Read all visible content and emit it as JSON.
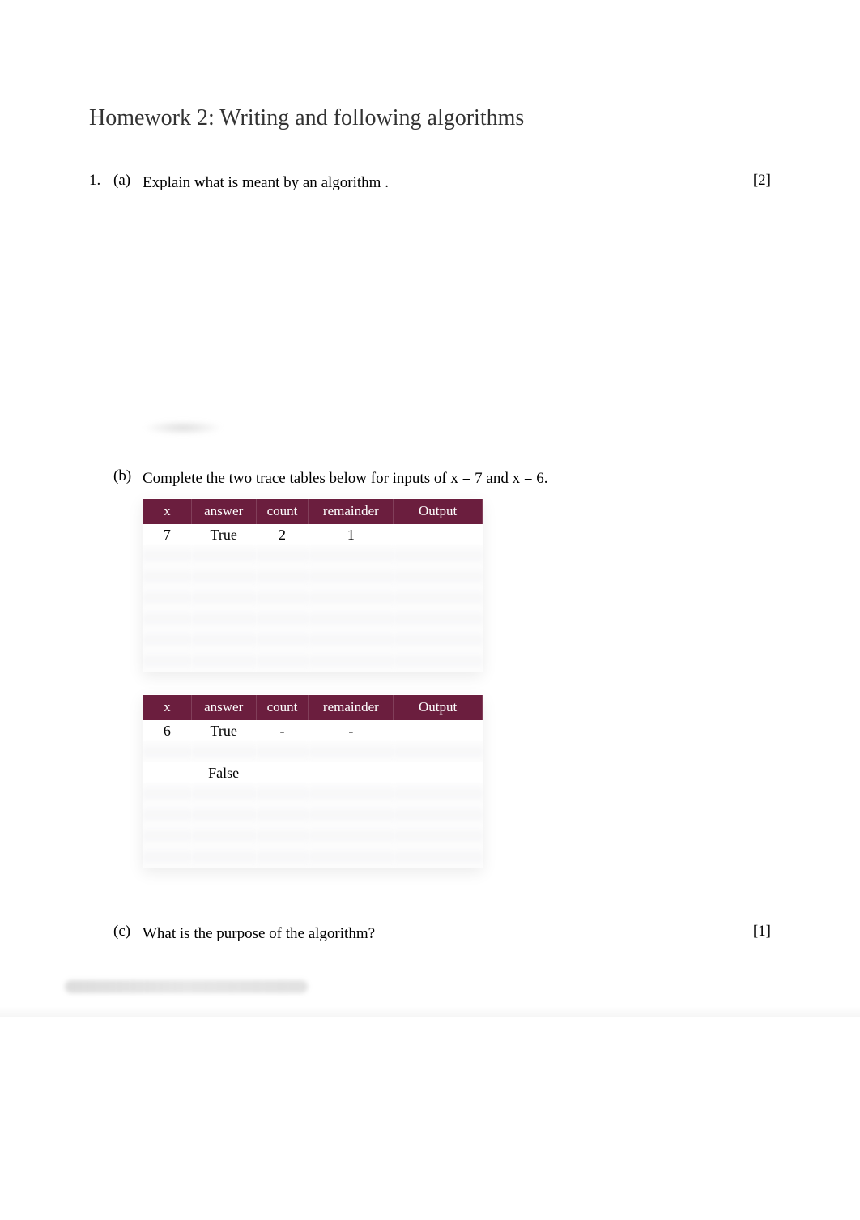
{
  "title": "Homework 2: Writing and following algorithms",
  "q1": {
    "number": "1.",
    "a": {
      "label": "(a)",
      "text_prefix": "Explain what is meant by an ",
      "text_keyword": "algorithm",
      "text_suffix": " .",
      "marks": "[2]"
    },
    "b": {
      "label": "(b)",
      "text": "Complete the two trace tables below for inputs of x = 7 and x = 6."
    },
    "c": {
      "label": "(c)",
      "text": "What is the purpose of the algorithm?",
      "marks": "[1]"
    }
  },
  "table_headers": {
    "x": "x",
    "answer": "answer",
    "count": "count",
    "remainder": "remainder",
    "output": "Output"
  },
  "table1": {
    "rows": [
      {
        "x": "7",
        "answer": "True",
        "count": "2",
        "remainder": "1",
        "output": ""
      },
      {
        "x": "",
        "answer": "",
        "count": "",
        "remainder": "",
        "output": ""
      },
      {
        "x": "",
        "answer": "",
        "count": "",
        "remainder": "",
        "output": ""
      },
      {
        "x": "",
        "answer": "",
        "count": "",
        "remainder": "",
        "output": ""
      },
      {
        "x": "",
        "answer": "",
        "count": "",
        "remainder": "",
        "output": ""
      },
      {
        "x": "",
        "answer": "",
        "count": "",
        "remainder": "",
        "output": ""
      },
      {
        "x": "",
        "answer": "",
        "count": "",
        "remainder": "",
        "output": ""
      }
    ]
  },
  "table2": {
    "rows": [
      {
        "x": "6",
        "answer": "True",
        "count": "-",
        "remainder": "-",
        "output": ""
      },
      {
        "x": "",
        "answer": "",
        "count": "",
        "remainder": "",
        "output": ""
      },
      {
        "x": "",
        "answer": "False",
        "count": "",
        "remainder": "",
        "output": ""
      },
      {
        "x": "",
        "answer": "",
        "count": "",
        "remainder": "",
        "output": ""
      },
      {
        "x": "",
        "answer": "",
        "count": "",
        "remainder": "",
        "output": ""
      },
      {
        "x": "",
        "answer": "",
        "count": "",
        "remainder": "",
        "output": ""
      },
      {
        "x": "",
        "answer": "",
        "count": "",
        "remainder": "",
        "output": ""
      }
    ]
  }
}
